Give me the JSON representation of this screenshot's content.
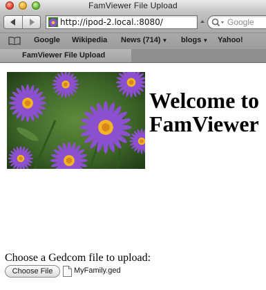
{
  "window": {
    "title": "FamViewer File Upload"
  },
  "toolbar": {
    "url": "http://ipod-2.local.:8080/",
    "search_placeholder": "Google"
  },
  "bookmarks": {
    "items": [
      {
        "label": "Google",
        "has_menu": false
      },
      {
        "label": "Wikipedia",
        "has_menu": false
      },
      {
        "label": "News (714)",
        "has_menu": true
      },
      {
        "label": "blogs",
        "has_menu": true
      },
      {
        "label": "Yahoo!",
        "has_menu": false
      }
    ]
  },
  "tabs": [
    {
      "label": "FamViewer File Upload",
      "active": true
    }
  ],
  "page": {
    "heading": "Welcome to FamViewer",
    "photo_alt": "purple-aster-flowers-photo",
    "upload_label": "Choose a Gedcom file to upload:",
    "choose_button": "Choose File",
    "selected_file": "MyFamily.ged"
  },
  "colors": {
    "flower_petal": "#8b4fcf",
    "flower_center": "#f2b325",
    "foliage": "#3f6d2a"
  }
}
